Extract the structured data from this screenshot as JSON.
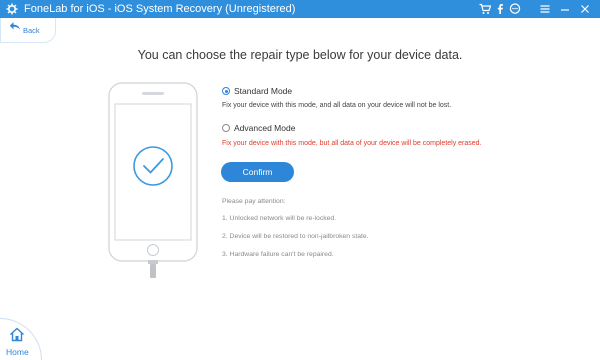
{
  "window": {
    "title": "FoneLab for iOS - iOS System Recovery (Unregistered)",
    "accent_color": "#2f8fdc",
    "toolbar_icons": [
      "cart-icon",
      "facebook-icon",
      "chat-icon",
      "menu-icon",
      "minimize-icon",
      "close-icon"
    ]
  },
  "nav": {
    "back_label": "Back",
    "home_label": "Home"
  },
  "main": {
    "heading": "You can choose the repair type below for your device data.",
    "modes": [
      {
        "label": "Standard Mode",
        "selected": true,
        "description": "Fix your device with this mode, and all data on your device will not be lost."
      },
      {
        "label": "Advanced Mode",
        "selected": false,
        "description": "Fix your device with this mode, but all data of your device will be completely erased.",
        "description_color": "#e23b2c"
      }
    ],
    "confirm_label": "Confirm",
    "attention": {
      "title": "Please pay attention:",
      "items": [
        "1. Unlocked network will be re-locked.",
        "2. Device will be restored to non-jailbroken state.",
        "3. Hardware failure can't be repaired."
      ]
    }
  }
}
